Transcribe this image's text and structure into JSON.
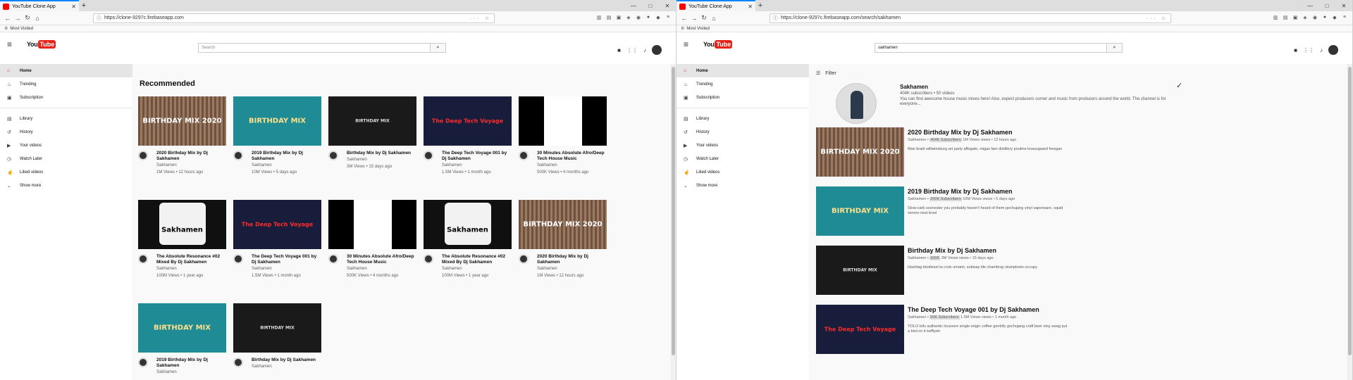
{
  "browser": {
    "tab_title": "YouTube Clone App",
    "close": "✕",
    "new_tab": "+",
    "bookmarks": "Most Visited"
  },
  "left": {
    "url": "https://clone-9297c.firebaseapp.com",
    "search_placeholder": "Search",
    "heading": "Recommended",
    "sidebar": [
      {
        "label": "Home",
        "icon": "home-icon"
      },
      {
        "label": "Trending",
        "icon": "flame-icon"
      },
      {
        "label": "Subscription",
        "icon": "subscription-icon"
      },
      {
        "label": "Library",
        "icon": "library-icon"
      },
      {
        "label": "History",
        "icon": "history-icon"
      },
      {
        "label": "Your videos",
        "icon": "video-icon"
      },
      {
        "label": "Watch Later",
        "icon": "clock-icon"
      },
      {
        "label": "Liked videos",
        "icon": "thumb-up-icon"
      },
      {
        "label": "Show more",
        "icon": "chevron-down-icon"
      }
    ],
    "videos": [
      {
        "title": "2020 Birthday Mix by Dj Sakhamen",
        "channel": "Sakhamen",
        "meta": "1M Views • 12 hours ago",
        "thumb_text": "BIRTHDAY MIX 2020"
      },
      {
        "title": "2019 Birthday Mix by Dj Sakhamen",
        "channel": "Sakhamen",
        "meta": "10M Views • 5 days ago",
        "thumb_text": "BIRTHDAY MIX"
      },
      {
        "title": "Birthday Mix by Dj Sakhamen",
        "channel": "Sakhamen",
        "meta": "3M Views • 15 days ago",
        "thumb_text": "BIRTHDAY MIX"
      },
      {
        "title": "The Deep Tech Voyage 001 by Dj Sakhamen",
        "channel": "Sakhamen",
        "meta": "1.5M Views • 1 month ago",
        "thumb_text": "The Deep Tech Voyage"
      },
      {
        "title": "30 Minutes Absolute Afro/Deep Tech House Music",
        "channel": "Sakhamen",
        "meta": "500K Views • 4 months ago",
        "thumb_text": ""
      },
      {
        "title": "The Absolute Resonance #02 Mixed By Dj Sakhamen",
        "channel": "Sakhamen",
        "meta": "100M Views • 1 year ago",
        "thumb_text": "Sakhamen"
      },
      {
        "title": "The Deep Tech Voyage 001 by Dj Sakhamen",
        "channel": "Sakhamen",
        "meta": "1.5M Views • 1 month ago",
        "thumb_text": "The Deep Tech Voyage"
      },
      {
        "title": "30 Minutes Absolute Afro/Deep Tech House Music",
        "channel": "Sakhamen",
        "meta": "500K Views • 4 months ago",
        "thumb_text": ""
      },
      {
        "title": "The Absolute Resonance #02 Mixed By Dj Sakhamen",
        "channel": "Sakhamen",
        "meta": "100M Views • 1 year ago",
        "thumb_text": "Sakhamen"
      },
      {
        "title": "2020 Birthday Mix by Dj Sakhamen",
        "channel": "Sakhamen",
        "meta": "1M Views • 12 hours ago",
        "thumb_text": "BIRTHDAY MIX 2020"
      },
      {
        "title": "2019 Birthday Mix by Dj Sakhamen",
        "channel": "Sakhamen",
        "meta": "",
        "thumb_text": "BIRTHDAY MIX"
      },
      {
        "title": "Birthday Mix by Dj Sakhamen",
        "channel": "Sakhamen",
        "meta": "",
        "thumb_text": "BIRTHDAY MIX"
      }
    ]
  },
  "right": {
    "url": "https://clone-9297c.firebaseapp.com/search/sakhamen",
    "search_value": "sakhamen",
    "filter_label": "Filter",
    "channel": {
      "name": "Sakhamen",
      "stats": "404K subscribers • 50 videos",
      "description": "You can find awesome house music mixes here! Also, expect producers corner and music from producers around the world. The channel is for everyone..."
    },
    "results": [
      {
        "title": "2020 Birthday Mix by Dj Sakhamen",
        "channel": "Sakhamen",
        "subs": "404K Subscribers",
        "meta": "1M Views views • 12 hours ago",
        "desc": "Man braid williamsburg art party affogato, migas fam distillery poutine knausgaard freegan"
      },
      {
        "title": "2019 Birthday Mix by Dj Sakhamen",
        "channel": "Sakhamen",
        "subs": "200K Subscribers",
        "meta": "10M Views views • 5 days ago",
        "desc": "Slow-carb scenester you probably haven't heard of them gochujang vinyl vaporware, squid venmo next level"
      },
      {
        "title": "Birthday Mix by Dj Sakhamen",
        "channel": "Sakhamen",
        "subs": "300K",
        "meta": "3M Views views • 15 days ago",
        "desc": "Hashtag biodiesel la croix umami, subway tile chambray stumptown occupy."
      },
      {
        "title": "The Deep Tech Voyage 001 by Dj Sakhamen",
        "channel": "Sakhamen",
        "subs": "50K Subscribers",
        "meta": "1.5M Views views • 1 month ago",
        "desc": "YOLO tofu authentic locavore single-origin coffee gentrify gochujang craft beer etsy swag put a bird on it keffiyeh"
      }
    ]
  }
}
